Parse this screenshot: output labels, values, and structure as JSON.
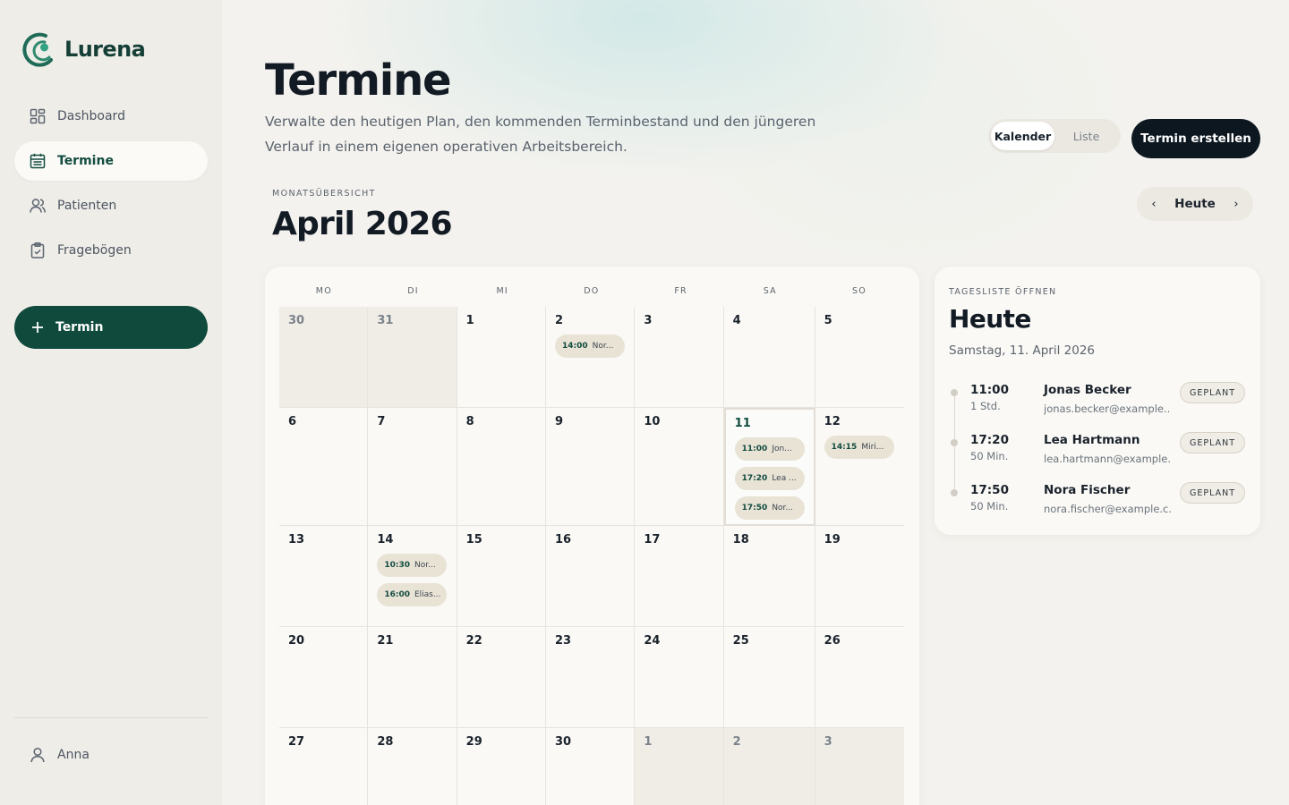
{
  "app": {
    "name": "Lurena"
  },
  "sidebar": {
    "items": [
      {
        "label": "Dashboard",
        "icon": "dashboard-icon",
        "active": false
      },
      {
        "label": "Termine",
        "icon": "calendar-icon",
        "active": true
      },
      {
        "label": "Patienten",
        "icon": "users-icon",
        "active": false
      },
      {
        "label": "Fragebögen",
        "icon": "clipboard-icon",
        "active": false
      }
    ],
    "new_button": "Termin",
    "user": "Anna"
  },
  "header": {
    "title": "Termine",
    "subtitle": "Verwalte den heutigen Plan, den kommenden Terminbestand und den jüngeren Verlauf in einem eigenen operativen Arbeitsbereich.",
    "view_toggle": {
      "calendar": "Kalender",
      "list": "Liste",
      "selected": "Kalender"
    },
    "create_button": "Termin erstellen"
  },
  "month": {
    "kicker": "MONATSÜBERSICHT",
    "title": "April 2026",
    "nav": {
      "prev": "‹",
      "today": "Heute",
      "next": "›"
    }
  },
  "calendar": {
    "weekdays": [
      "MO",
      "DI",
      "MI",
      "DO",
      "FR",
      "SA",
      "SO"
    ],
    "weeks": [
      [
        {
          "day": "30",
          "out": true,
          "events": []
        },
        {
          "day": "31",
          "out": true,
          "events": []
        },
        {
          "day": "1",
          "events": []
        },
        {
          "day": "2",
          "events": [
            {
              "time": "14:00",
              "name": "Nor..."
            }
          ]
        },
        {
          "day": "3",
          "events": []
        },
        {
          "day": "4",
          "events": []
        },
        {
          "day": "5",
          "events": []
        }
      ],
      [
        {
          "day": "6",
          "events": []
        },
        {
          "day": "7",
          "events": []
        },
        {
          "day": "8",
          "events": []
        },
        {
          "day": "9",
          "events": []
        },
        {
          "day": "10",
          "events": []
        },
        {
          "day": "11",
          "today": true,
          "events": [
            {
              "time": "11:00",
              "name": "Jon..."
            },
            {
              "time": "17:20",
              "name": "Lea ..."
            },
            {
              "time": "17:50",
              "name": "Nor..."
            }
          ]
        },
        {
          "day": "12",
          "events": [
            {
              "time": "14:15",
              "name": "Miri..."
            }
          ]
        }
      ],
      [
        {
          "day": "13",
          "events": []
        },
        {
          "day": "14",
          "events": [
            {
              "time": "10:30",
              "name": "Nor..."
            },
            {
              "time": "16:00",
              "name": "Elias..."
            }
          ]
        },
        {
          "day": "15",
          "events": []
        },
        {
          "day": "16",
          "events": []
        },
        {
          "day": "17",
          "events": []
        },
        {
          "day": "18",
          "events": []
        },
        {
          "day": "19",
          "events": []
        }
      ],
      [
        {
          "day": "20",
          "events": []
        },
        {
          "day": "21",
          "events": []
        },
        {
          "day": "22",
          "events": []
        },
        {
          "day": "23",
          "events": []
        },
        {
          "day": "24",
          "events": []
        },
        {
          "day": "25",
          "events": []
        },
        {
          "day": "26",
          "events": []
        }
      ],
      [
        {
          "day": "27",
          "events": []
        },
        {
          "day": "28",
          "events": []
        },
        {
          "day": "29",
          "events": []
        },
        {
          "day": "30",
          "events": []
        },
        {
          "day": "1",
          "out": true,
          "events": []
        },
        {
          "day": "2",
          "out": true,
          "events": []
        },
        {
          "day": "3",
          "out": true,
          "events": []
        }
      ]
    ]
  },
  "day_panel": {
    "kicker": "TAGESLISTE ÖFFNEN",
    "title": "Heute",
    "date": "Samstag, 11. April 2026",
    "appointments": [
      {
        "time": "11:00",
        "duration": "1 Std.",
        "name": "Jonas Becker",
        "email": "jonas.becker@example....",
        "status": "GEPLANT"
      },
      {
        "time": "17:20",
        "duration": "50 Min.",
        "name": "Lea Hartmann",
        "email": "lea.hartmann@example...",
        "status": "GEPLANT"
      },
      {
        "time": "17:50",
        "duration": "50 Min.",
        "name": "Nora Fischer",
        "email": "nora.fischer@example.c...",
        "status": "GEPLANT"
      }
    ]
  },
  "colors": {
    "accent": "#0f4a3c",
    "dark": "#0c1720",
    "event_bg": "#e9e3d6"
  }
}
